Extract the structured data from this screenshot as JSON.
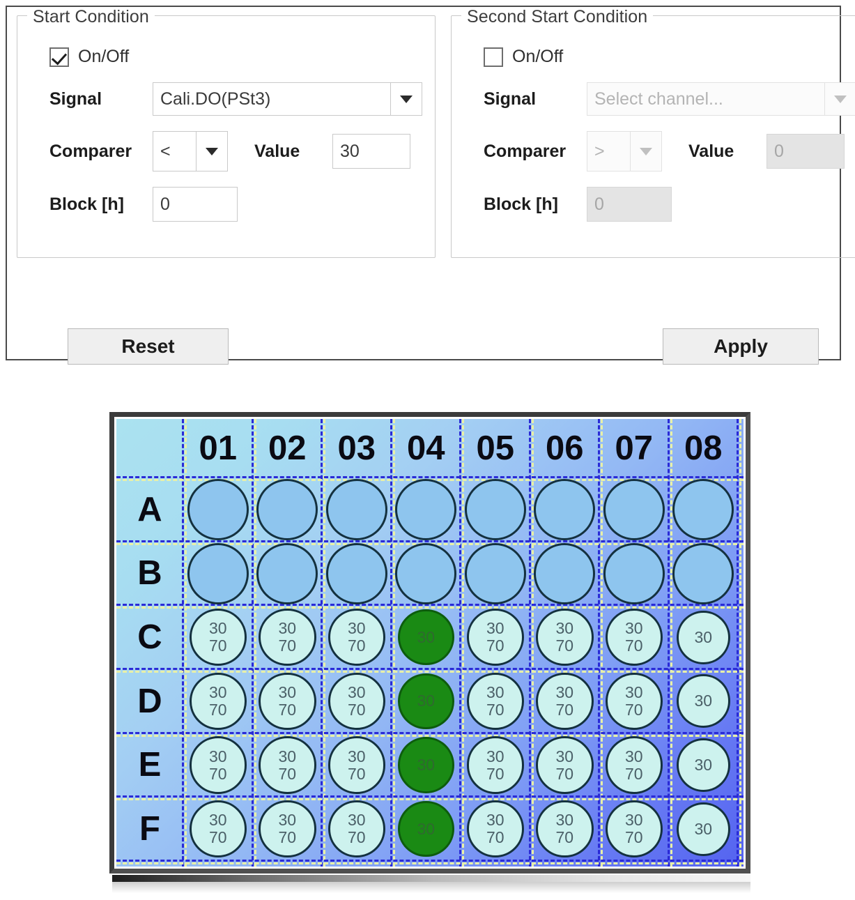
{
  "form": {
    "start_condition": {
      "legend": "Start Condition",
      "enabled": true,
      "onoff_label": "On/Off",
      "signal_label": "Signal",
      "signal_value": "Cali.DO(PSt3)",
      "signal_placeholder": "Select channel...",
      "comparer_label": "Comparer",
      "comparer_value": "<",
      "value_label": "Value",
      "value_value": "30",
      "block_label": "Block [h]",
      "block_value": "0"
    },
    "second_start_condition": {
      "legend": "Second Start Condition",
      "enabled": false,
      "onoff_label": "On/Off",
      "signal_label": "Signal",
      "signal_value": "Select channel...",
      "signal_placeholder": "Select channel...",
      "comparer_label": "Comparer",
      "comparer_value": ">",
      "value_label": "Value",
      "value_value": "0",
      "block_label": "Block [h]",
      "block_value": "0"
    },
    "reset_label": "Reset",
    "apply_label": "Apply"
  },
  "plate": {
    "columns": [
      "01",
      "02",
      "03",
      "04",
      "05",
      "06",
      "07",
      "08"
    ],
    "rows": [
      "A",
      "B",
      "C",
      "D",
      "E",
      "F"
    ],
    "colors": {
      "well_empty": "#8ec5ee",
      "well_filled": "#cdf2ee",
      "well_active": "#1a8a14",
      "well_border": "#14313f",
      "gridline_blue": "#2b2bd6",
      "gridline_yellow": "#e8f0a8",
      "bg_start": "#abe2f0",
      "bg_end": "#5463f0",
      "frame": "#4f4f4f"
    },
    "wells": {
      "A": [
        {
          "state": "empty",
          "v1": "",
          "v2": ""
        },
        {
          "state": "empty",
          "v1": "",
          "v2": ""
        },
        {
          "state": "empty",
          "v1": "",
          "v2": ""
        },
        {
          "state": "empty",
          "v1": "",
          "v2": ""
        },
        {
          "state": "empty",
          "v1": "",
          "v2": ""
        },
        {
          "state": "empty",
          "v1": "",
          "v2": ""
        },
        {
          "state": "empty",
          "v1": "",
          "v2": ""
        },
        {
          "state": "empty",
          "v1": "",
          "v2": ""
        }
      ],
      "B": [
        {
          "state": "empty",
          "v1": "",
          "v2": ""
        },
        {
          "state": "empty",
          "v1": "",
          "v2": ""
        },
        {
          "state": "empty",
          "v1": "",
          "v2": ""
        },
        {
          "state": "empty",
          "v1": "",
          "v2": ""
        },
        {
          "state": "empty",
          "v1": "",
          "v2": ""
        },
        {
          "state": "empty",
          "v1": "",
          "v2": ""
        },
        {
          "state": "empty",
          "v1": "",
          "v2": ""
        },
        {
          "state": "empty",
          "v1": "",
          "v2": ""
        }
      ],
      "C": [
        {
          "state": "filled",
          "v1": "30",
          "v2": "70"
        },
        {
          "state": "filled",
          "v1": "30",
          "v2": "70"
        },
        {
          "state": "filled",
          "v1": "30",
          "v2": "70"
        },
        {
          "state": "active",
          "v1": "30",
          "v2": ""
        },
        {
          "state": "filled",
          "v1": "30",
          "v2": "70"
        },
        {
          "state": "filled",
          "v1": "30",
          "v2": "70"
        },
        {
          "state": "filled",
          "v1": "30",
          "v2": "70"
        },
        {
          "state": "filled",
          "v1": "30",
          "v2": ""
        }
      ],
      "D": [
        {
          "state": "filled",
          "v1": "30",
          "v2": "70"
        },
        {
          "state": "filled",
          "v1": "30",
          "v2": "70"
        },
        {
          "state": "filled",
          "v1": "30",
          "v2": "70"
        },
        {
          "state": "active",
          "v1": "30",
          "v2": ""
        },
        {
          "state": "filled",
          "v1": "30",
          "v2": "70"
        },
        {
          "state": "filled",
          "v1": "30",
          "v2": "70"
        },
        {
          "state": "filled",
          "v1": "30",
          "v2": "70"
        },
        {
          "state": "filled",
          "v1": "30",
          "v2": ""
        }
      ],
      "E": [
        {
          "state": "filled",
          "v1": "30",
          "v2": "70"
        },
        {
          "state": "filled",
          "v1": "30",
          "v2": "70"
        },
        {
          "state": "filled",
          "v1": "30",
          "v2": "70"
        },
        {
          "state": "active",
          "v1": "30",
          "v2": ""
        },
        {
          "state": "filled",
          "v1": "30",
          "v2": "70"
        },
        {
          "state": "filled",
          "v1": "30",
          "v2": "70"
        },
        {
          "state": "filled",
          "v1": "30",
          "v2": "70"
        },
        {
          "state": "filled",
          "v1": "30",
          "v2": ""
        }
      ],
      "F": [
        {
          "state": "filled",
          "v1": "30",
          "v2": "70"
        },
        {
          "state": "filled",
          "v1": "30",
          "v2": "70"
        },
        {
          "state": "filled",
          "v1": "30",
          "v2": "70"
        },
        {
          "state": "active",
          "v1": "30",
          "v2": ""
        },
        {
          "state": "filled",
          "v1": "30",
          "v2": "70"
        },
        {
          "state": "filled",
          "v1": "30",
          "v2": "70"
        },
        {
          "state": "filled",
          "v1": "30",
          "v2": "70"
        },
        {
          "state": "filled",
          "v1": "30",
          "v2": ""
        }
      ]
    }
  }
}
